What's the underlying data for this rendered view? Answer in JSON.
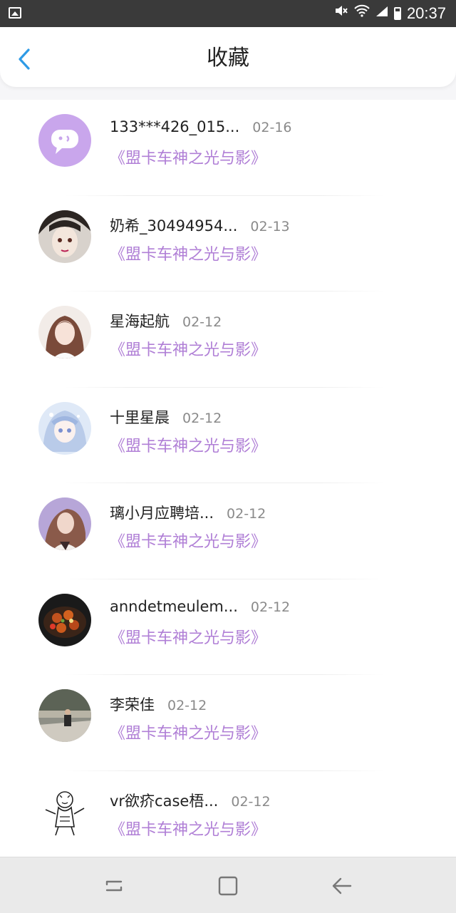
{
  "status_bar": {
    "time": "20:37",
    "icons": [
      "image-icon",
      "mute-icon",
      "wifi-icon",
      "signal-icon",
      "battery-icon"
    ]
  },
  "header": {
    "title": "收藏",
    "back_icon": "chevron-left-icon",
    "accent_color": "#2f9be6"
  },
  "favorites": [
    {
      "user": "133***426_015...",
      "date": "02-16",
      "title": "《盟卡车神之光与影》"
    },
    {
      "user": "奶希_30494954...",
      "date": "02-13",
      "title": "《盟卡车神之光与影》"
    },
    {
      "user": "星海起航",
      "date": "02-12",
      "title": "《盟卡车神之光与影》"
    },
    {
      "user": "十里星晨",
      "date": "02-12",
      "title": "《盟卡车神之光与影》"
    },
    {
      "user": "璃小月应聘培...",
      "date": "02-12",
      "title": "《盟卡车神之光与影》"
    },
    {
      "user": "anndetmeulem...",
      "date": "02-12",
      "title": "《盟卡车神之光与影》"
    },
    {
      "user": "李荣佳",
      "date": "02-12",
      "title": "《盟卡车神之光与影》"
    },
    {
      "user": "vr欲疥case梧...",
      "date": "02-12",
      "title": "《盟卡车神之光与影》"
    }
  ],
  "colors": {
    "title_purple": "#b07fd6",
    "default_avatar": "#c9a6ec"
  },
  "nav_bar": {
    "buttons": [
      "recent-apps-icon",
      "home-icon",
      "back-arrow-icon"
    ]
  }
}
